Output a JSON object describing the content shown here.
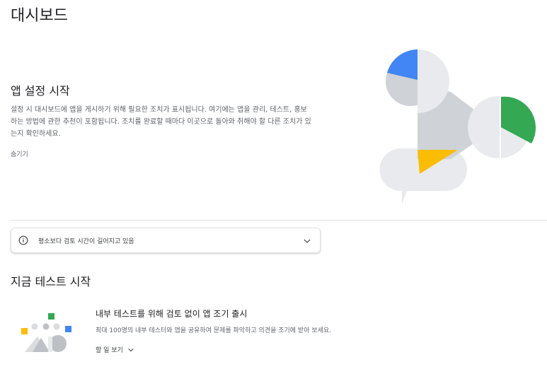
{
  "page": {
    "title": "대시보드"
  },
  "setup": {
    "title": "앱 설정 시작",
    "description": "설정 시 대시보드에 앱을 게시하기 위해 필요한 조치가 표시됩니다. 여기에는 앱을 관리, 테스트, 홍보하는 방법에 관한 추천이 포함됩니다. 조치를 완료할 때마다 이곳으로 돌아와 취해야 할 다른 조치가 있는지 확인하세요.",
    "hide_label": "숨기기"
  },
  "notice": {
    "text": "평소보다 검토 시간이 길어지고 있음",
    "icon": "info-icon"
  },
  "testing": {
    "title": "지금 테스트 시작",
    "release_title": "내부 테스트를 위해 검토 없이 앱 조기 출시",
    "release_description": "최대 100명의 내부 테스터와 앱을 공유하여 문제를 파악하고 의견을 조기에 받아 보세요.",
    "todo_label": "할 일 보기"
  },
  "colors": {
    "blue": "#4285f4",
    "green": "#34a853",
    "yellow": "#fbbc04",
    "red": "#ea4335",
    "gray_light": "#e8eaed",
    "gray_mid": "#dadce0",
    "gray_dark": "#bdc1c6"
  }
}
